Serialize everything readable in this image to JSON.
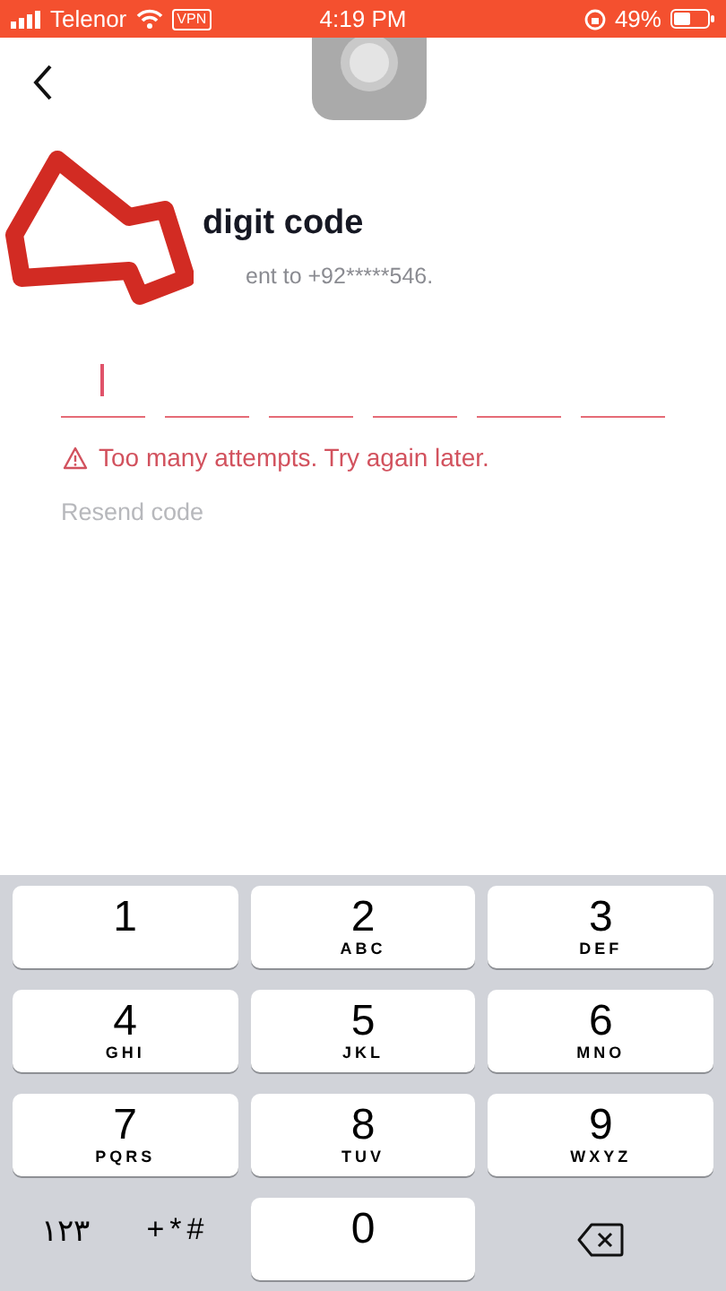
{
  "status_bar": {
    "carrier": "Telenor",
    "vpn": "VPN",
    "time": "4:19 PM",
    "battery": "49%"
  },
  "title": "digit code",
  "subtitle": "ent to +92*****546.",
  "code_fields": [
    {
      "focused": true
    },
    {
      "focused": false
    },
    {
      "focused": false
    },
    {
      "focused": false
    },
    {
      "focused": false
    },
    {
      "focused": false
    }
  ],
  "error": "Too many attempts. Try again later.",
  "resend": "Resend code",
  "keypad": [
    {
      "kind": "digit",
      "digit": "1"
    },
    {
      "kind": "digit",
      "digit": "2",
      "letters": "ABC"
    },
    {
      "kind": "digit",
      "digit": "3",
      "letters": "DEF"
    },
    {
      "kind": "digit",
      "digit": "4",
      "letters": "GHI"
    },
    {
      "kind": "digit",
      "digit": "5",
      "letters": "JKL"
    },
    {
      "kind": "digit",
      "digit": "6",
      "letters": "MNO"
    },
    {
      "kind": "digit",
      "digit": "7",
      "letters": "PQRS"
    },
    {
      "kind": "digit",
      "digit": "8",
      "letters": "TUV"
    },
    {
      "kind": "digit",
      "digit": "9",
      "letters": "WXYZ"
    },
    {
      "kind": "symbols",
      "labels": [
        "١٢٣",
        "+*#"
      ]
    },
    {
      "kind": "digit",
      "digit": "0"
    },
    {
      "kind": "delete"
    }
  ]
}
